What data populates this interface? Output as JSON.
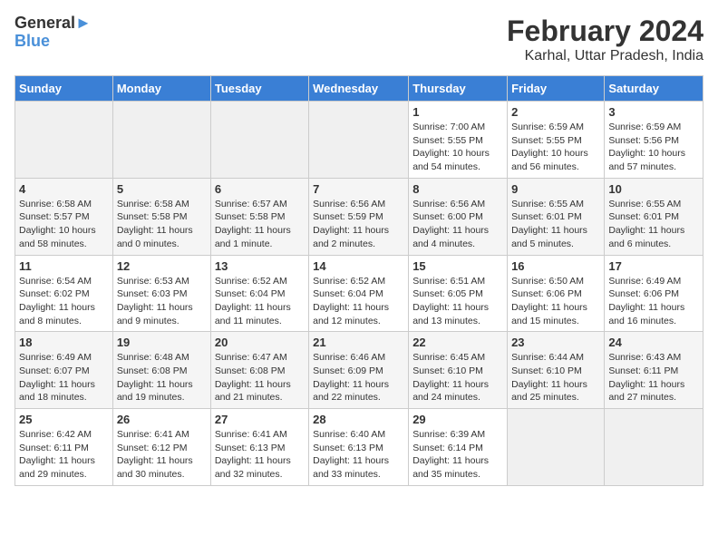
{
  "header": {
    "logo_general": "General",
    "logo_blue": "Blue",
    "title": "February 2024",
    "subtitle": "Karhal, Uttar Pradesh, India"
  },
  "days_of_week": [
    "Sunday",
    "Monday",
    "Tuesday",
    "Wednesday",
    "Thursday",
    "Friday",
    "Saturday"
  ],
  "weeks": [
    [
      {
        "day": "",
        "info": ""
      },
      {
        "day": "",
        "info": ""
      },
      {
        "day": "",
        "info": ""
      },
      {
        "day": "",
        "info": ""
      },
      {
        "day": "1",
        "info": "Sunrise: 7:00 AM\nSunset: 5:55 PM\nDaylight: 10 hours and 54 minutes."
      },
      {
        "day": "2",
        "info": "Sunrise: 6:59 AM\nSunset: 5:55 PM\nDaylight: 10 hours and 56 minutes."
      },
      {
        "day": "3",
        "info": "Sunrise: 6:59 AM\nSunset: 5:56 PM\nDaylight: 10 hours and 57 minutes."
      }
    ],
    [
      {
        "day": "4",
        "info": "Sunrise: 6:58 AM\nSunset: 5:57 PM\nDaylight: 10 hours and 58 minutes."
      },
      {
        "day": "5",
        "info": "Sunrise: 6:58 AM\nSunset: 5:58 PM\nDaylight: 11 hours and 0 minutes."
      },
      {
        "day": "6",
        "info": "Sunrise: 6:57 AM\nSunset: 5:58 PM\nDaylight: 11 hours and 1 minute."
      },
      {
        "day": "7",
        "info": "Sunrise: 6:56 AM\nSunset: 5:59 PM\nDaylight: 11 hours and 2 minutes."
      },
      {
        "day": "8",
        "info": "Sunrise: 6:56 AM\nSunset: 6:00 PM\nDaylight: 11 hours and 4 minutes."
      },
      {
        "day": "9",
        "info": "Sunrise: 6:55 AM\nSunset: 6:01 PM\nDaylight: 11 hours and 5 minutes."
      },
      {
        "day": "10",
        "info": "Sunrise: 6:55 AM\nSunset: 6:01 PM\nDaylight: 11 hours and 6 minutes."
      }
    ],
    [
      {
        "day": "11",
        "info": "Sunrise: 6:54 AM\nSunset: 6:02 PM\nDaylight: 11 hours and 8 minutes."
      },
      {
        "day": "12",
        "info": "Sunrise: 6:53 AM\nSunset: 6:03 PM\nDaylight: 11 hours and 9 minutes."
      },
      {
        "day": "13",
        "info": "Sunrise: 6:52 AM\nSunset: 6:04 PM\nDaylight: 11 hours and 11 minutes."
      },
      {
        "day": "14",
        "info": "Sunrise: 6:52 AM\nSunset: 6:04 PM\nDaylight: 11 hours and 12 minutes."
      },
      {
        "day": "15",
        "info": "Sunrise: 6:51 AM\nSunset: 6:05 PM\nDaylight: 11 hours and 13 minutes."
      },
      {
        "day": "16",
        "info": "Sunrise: 6:50 AM\nSunset: 6:06 PM\nDaylight: 11 hours and 15 minutes."
      },
      {
        "day": "17",
        "info": "Sunrise: 6:49 AM\nSunset: 6:06 PM\nDaylight: 11 hours and 16 minutes."
      }
    ],
    [
      {
        "day": "18",
        "info": "Sunrise: 6:49 AM\nSunset: 6:07 PM\nDaylight: 11 hours and 18 minutes."
      },
      {
        "day": "19",
        "info": "Sunrise: 6:48 AM\nSunset: 6:08 PM\nDaylight: 11 hours and 19 minutes."
      },
      {
        "day": "20",
        "info": "Sunrise: 6:47 AM\nSunset: 6:08 PM\nDaylight: 11 hours and 21 minutes."
      },
      {
        "day": "21",
        "info": "Sunrise: 6:46 AM\nSunset: 6:09 PM\nDaylight: 11 hours and 22 minutes."
      },
      {
        "day": "22",
        "info": "Sunrise: 6:45 AM\nSunset: 6:10 PM\nDaylight: 11 hours and 24 minutes."
      },
      {
        "day": "23",
        "info": "Sunrise: 6:44 AM\nSunset: 6:10 PM\nDaylight: 11 hours and 25 minutes."
      },
      {
        "day": "24",
        "info": "Sunrise: 6:43 AM\nSunset: 6:11 PM\nDaylight: 11 hours and 27 minutes."
      }
    ],
    [
      {
        "day": "25",
        "info": "Sunrise: 6:42 AM\nSunset: 6:11 PM\nDaylight: 11 hours and 29 minutes."
      },
      {
        "day": "26",
        "info": "Sunrise: 6:41 AM\nSunset: 6:12 PM\nDaylight: 11 hours and 30 minutes."
      },
      {
        "day": "27",
        "info": "Sunrise: 6:41 AM\nSunset: 6:13 PM\nDaylight: 11 hours and 32 minutes."
      },
      {
        "day": "28",
        "info": "Sunrise: 6:40 AM\nSunset: 6:13 PM\nDaylight: 11 hours and 33 minutes."
      },
      {
        "day": "29",
        "info": "Sunrise: 6:39 AM\nSunset: 6:14 PM\nDaylight: 11 hours and 35 minutes."
      },
      {
        "day": "",
        "info": ""
      },
      {
        "day": "",
        "info": ""
      }
    ]
  ]
}
